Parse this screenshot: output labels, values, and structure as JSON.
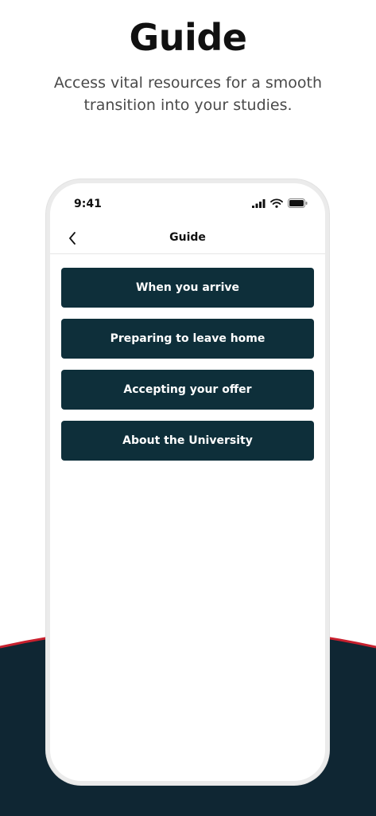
{
  "hero": {
    "title": "Guide",
    "subtitle": "Access vital resources for a smooth transition into your studies."
  },
  "status_bar": {
    "time": "9:41",
    "icons": [
      "signal-icon",
      "wifi-icon",
      "battery-icon"
    ]
  },
  "nav": {
    "title": "Guide",
    "back_icon": "chevron-left-icon"
  },
  "guide_items": [
    {
      "label": "When you arrive"
    },
    {
      "label": "Preparing to leave home"
    },
    {
      "label": "Accepting your offer"
    },
    {
      "label": "About the University"
    }
  ],
  "colors": {
    "button_bg": "#0e2f3a",
    "button_text": "#ffffff",
    "arc_dark": "#0f2633",
    "arc_accent": "#c8202e",
    "phone_frame": "#ebebeb"
  }
}
